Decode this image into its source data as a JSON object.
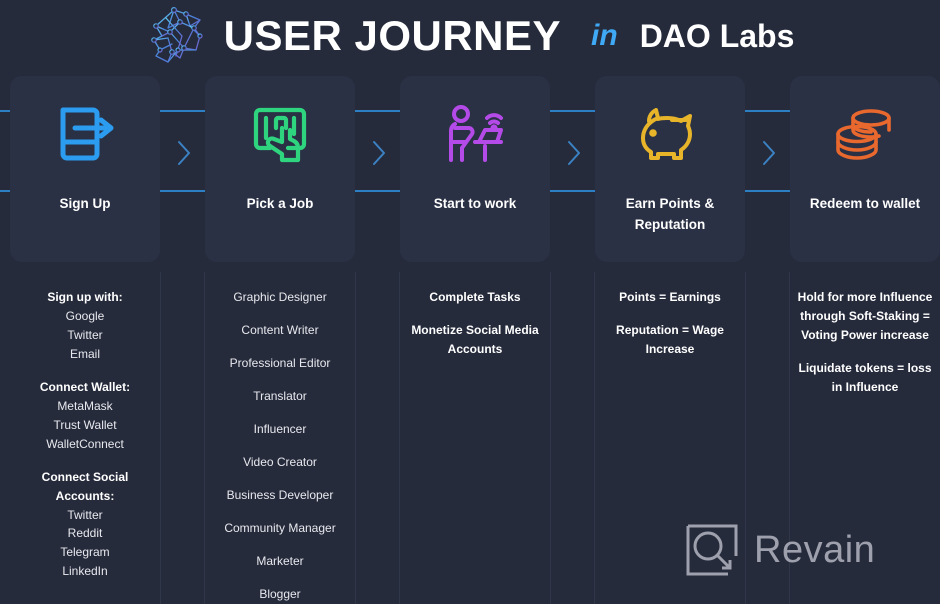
{
  "header": {
    "logo_icon": "dao-labs-network-wolf-logo",
    "title": "USER JOURNEY",
    "connector_word": "in",
    "brand": "DAO Labs"
  },
  "theme": {
    "background": "#262b3c",
    "card_background": "#2b3145",
    "connector_line": "#2d7fc4",
    "chevron": "#3b82c4",
    "accent_in": "#3fa9f5",
    "text_primary": "#ffffff",
    "text_secondary": "#e8e9ee",
    "divider": "#31374b"
  },
  "steps": [
    {
      "label": "Sign Up",
      "icon": "door-exit-arrow-icon",
      "icon_color": "#2b9cf0",
      "groups": [
        {
          "heading": "Sign up with:",
          "items": [
            "Google",
            "Twitter",
            "Email"
          ]
        },
        {
          "heading": "Connect Wallet:",
          "items": [
            "MetaMask",
            "Trust Wallet",
            "WalletConnect"
          ]
        },
        {
          "heading": "Connect Social Accounts:",
          "items": [
            "Twitter",
            "Reddit",
            "Telegram",
            "LinkedIn"
          ]
        }
      ]
    },
    {
      "label": "Pick a Job",
      "icon": "screen-hand-select-icon",
      "icon_color": "#2fd47e",
      "groups": [
        {
          "heading": "",
          "items": [
            "Graphic Designer"
          ]
        },
        {
          "heading": "",
          "items": [
            "Content Writer"
          ]
        },
        {
          "heading": "",
          "items": [
            "Professional Editor"
          ]
        },
        {
          "heading": "",
          "items": [
            "Translator"
          ]
        },
        {
          "heading": "",
          "items": [
            "Influencer"
          ]
        },
        {
          "heading": "",
          "items": [
            "Video Creator"
          ]
        },
        {
          "heading": "",
          "items": [
            "Business Developer"
          ]
        },
        {
          "heading": "",
          "items": [
            "Community Manager"
          ]
        },
        {
          "heading": "",
          "items": [
            "Marketer"
          ]
        },
        {
          "heading": "",
          "items": [
            "Blogger"
          ]
        }
      ]
    },
    {
      "label": "Start to work",
      "icon": "person-at-desk-wifi-icon",
      "icon_color": "#b44ae8",
      "groups": [
        {
          "heading": "Complete Tasks",
          "items": []
        },
        {
          "heading": "Monetize Social Media Accounts",
          "items": []
        }
      ]
    },
    {
      "label": "Earn Points & Reputation",
      "icon": "piggy-bank-icon",
      "icon_color": "#e8b52a",
      "groups": [
        {
          "heading": "Points = Earnings",
          "items": []
        },
        {
          "heading": "Reputation = Wage Increase",
          "items": []
        }
      ]
    },
    {
      "label": "Redeem to wallet",
      "icon": "stacked-coins-icon",
      "icon_color": "#e8682e",
      "groups": [
        {
          "heading": "Hold for more Influence through Soft-Staking = Voting Power increase",
          "items": []
        },
        {
          "heading": "Liquidate tokens = loss in Influence",
          "items": []
        }
      ]
    }
  ],
  "watermark": {
    "icon": "revain-logo-icon",
    "text": "Revain"
  }
}
